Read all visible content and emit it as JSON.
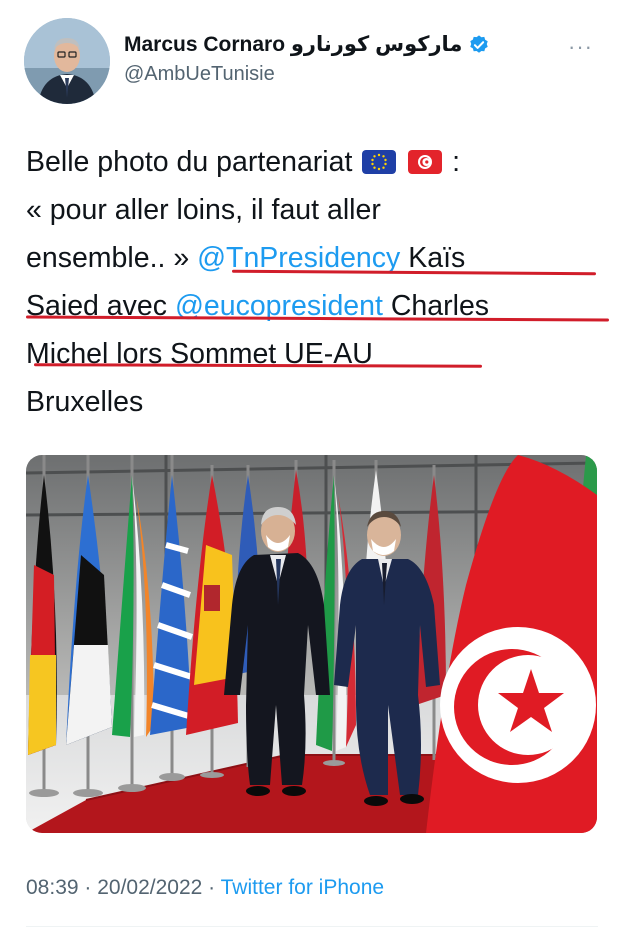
{
  "author": {
    "display_name": "Marcus Cornaro ماركوس كورنارو",
    "handle": "@AmbUeTunisie",
    "verified": true
  },
  "tweet": {
    "line1": "Belle photo du partenariat",
    "line1_end": ":",
    "line2": "« pour aller loins, il faut aller",
    "line3a": "ensemble.. » ",
    "mention1": "@TnPresidency",
    "line3b": " Kaïs",
    "line4a": "Saied avec ",
    "mention2": "@eucopresident",
    "line4b": " Charles",
    "line5": "Michel lors Sommet UE-AU",
    "line6": "Bruxelles"
  },
  "emoji": [
    "eu-flag-icon",
    "tunisia-flag-icon"
  ],
  "footer": {
    "time": "08:39",
    "separator": " · ",
    "date": "20/02/2022",
    "source": "Twitter for iPhone"
  },
  "colors": {
    "link": "#1d9bf0",
    "annotation_red": "#d11d2a",
    "text": "#0f1419",
    "muted": "#536471"
  }
}
